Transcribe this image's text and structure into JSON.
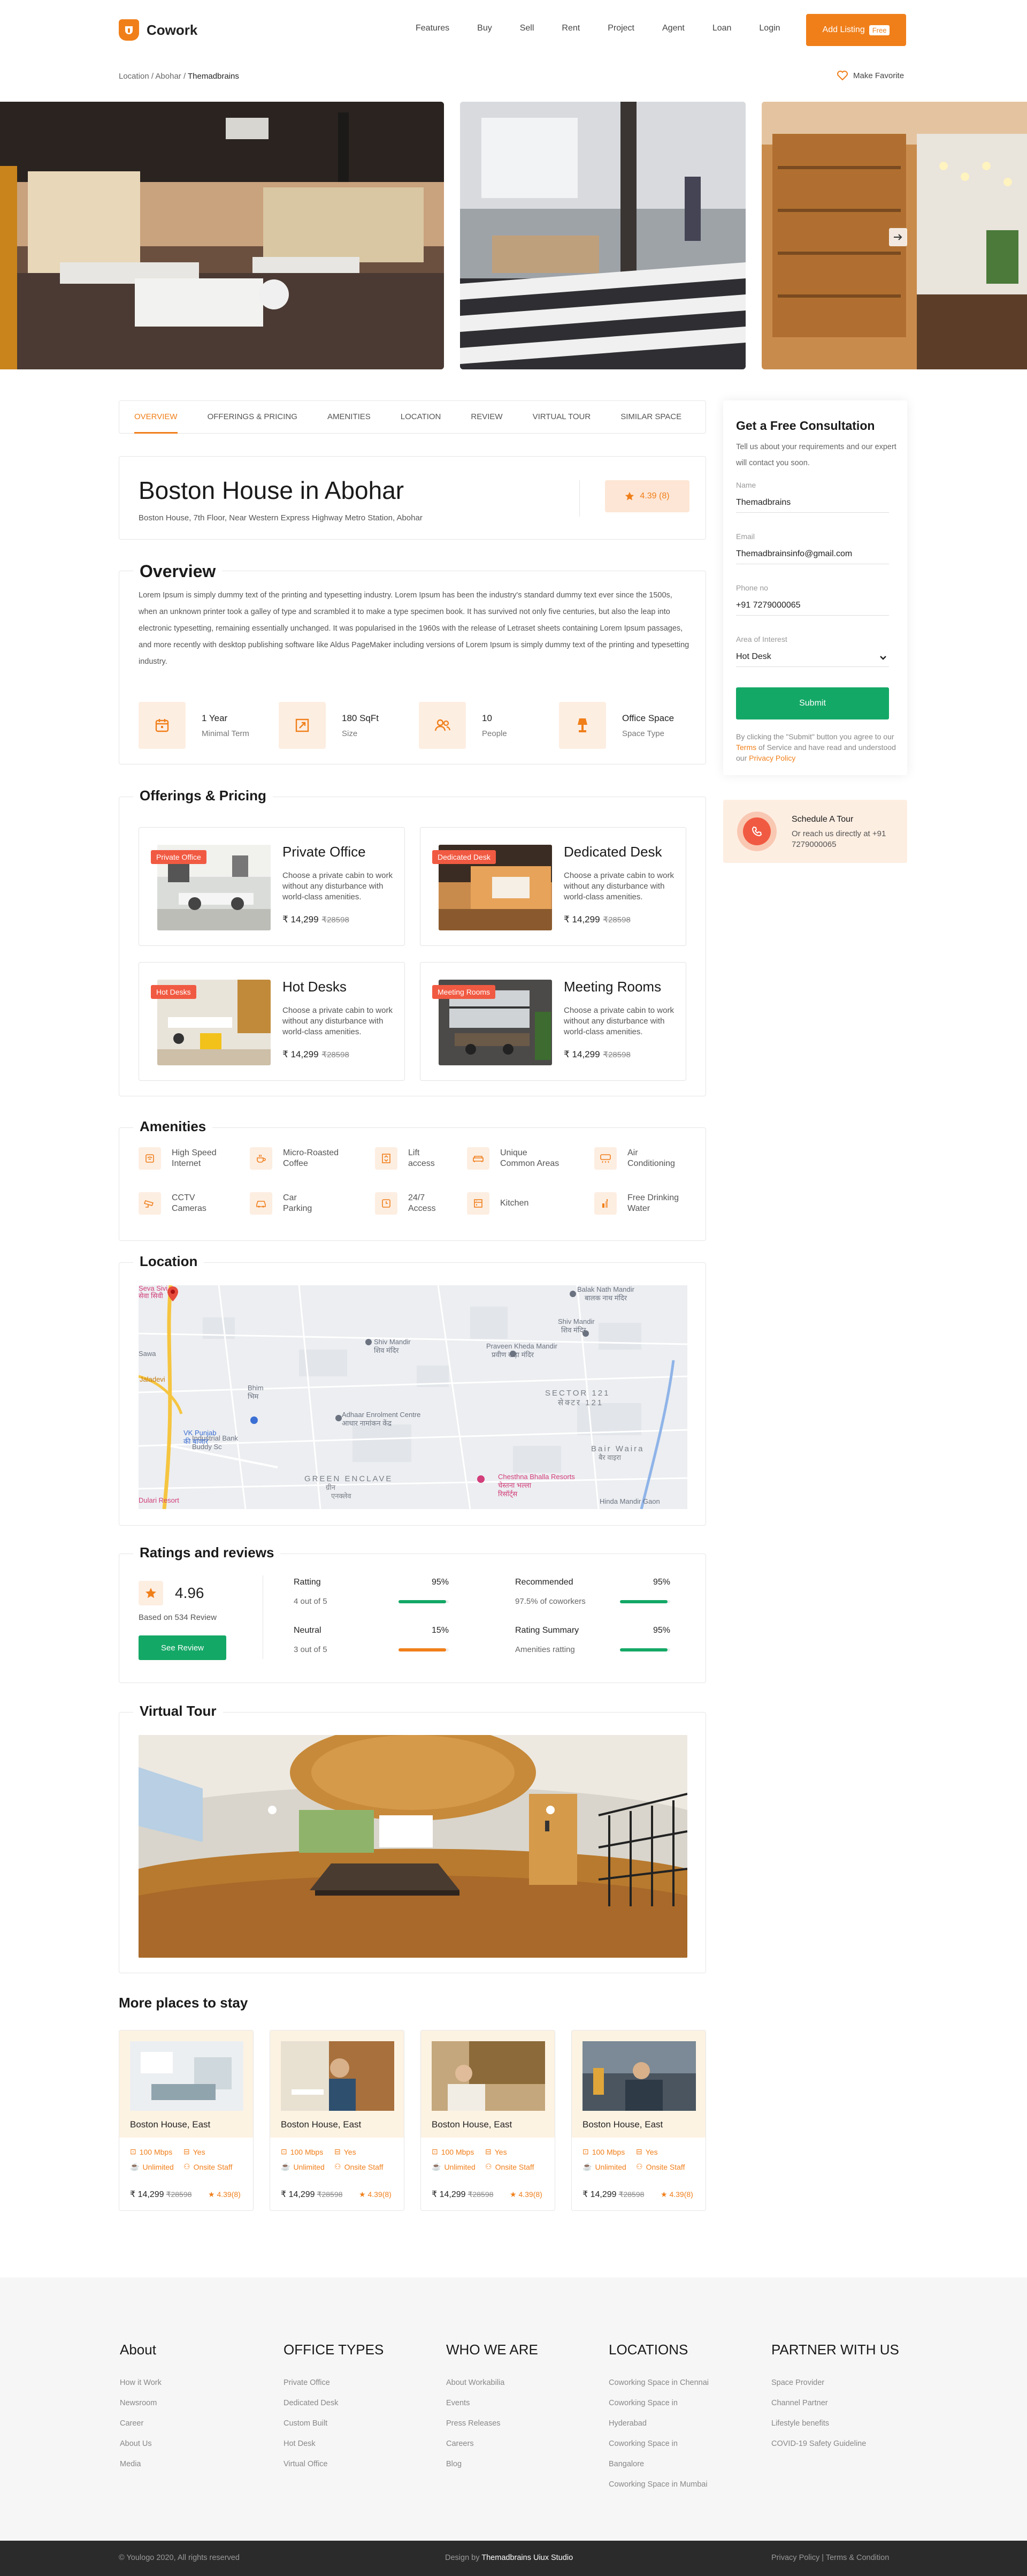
{
  "header": {
    "brand": "Cowork",
    "nav": [
      "Features",
      "Buy",
      "Sell",
      "Rent",
      "Project",
      "Agent",
      "Loan",
      "Login"
    ],
    "add_listing": "Add Listing",
    "free_badge": "Free"
  },
  "breadcrumb": {
    "parts": [
      "Location",
      "Abohar"
    ],
    "current": "Themadbrains"
  },
  "favorite_label": "Make Favorite",
  "tabs": [
    "OVERVIEW",
    "OFFERINGS & PRICING",
    "AMENITIES",
    "LOCATION",
    "REVIEW",
    "VIRTUAL TOUR",
    "SIMILAR SPACE"
  ],
  "property": {
    "title": "Boston House in Abohar",
    "address": "Boston House, 7th Floor, Near Western Express Highway Metro Station, Abohar",
    "rating": "4.39 (8)"
  },
  "overview": {
    "heading": "Overview",
    "text": "Lorem Ipsum is simply dummy text of the printing and typesetting industry. Lorem Ipsum has been the industry's standard dummy text ever since the 1500s, when an unknown printer took a galley of type and scrambled it to make a type specimen book. It has survived not only five centuries, but also the leap into electronic typesetting, remaining essentially unchanged. It was popularised in the 1960s with the release of Letraset sheets containing Lorem Ipsum passages, and more recently with desktop publishing software like Aldus PageMaker including versions of Lorem Ipsum is simply dummy text of the printing and typesetting industry.",
    "facts": [
      {
        "value": "1 Year",
        "label": "Minimal Term",
        "icon": "calendar-icon"
      },
      {
        "value": "180 SqFt",
        "label": "Size",
        "icon": "expand-icon"
      },
      {
        "value": "10",
        "label": "People",
        "icon": "people-icon"
      },
      {
        "value": "Office Space",
        "label": "Space Type",
        "icon": "lamp-icon"
      }
    ]
  },
  "offerings": {
    "heading": "Offerings & Pricing",
    "items": [
      {
        "badge": "Private Office",
        "name": "Private Office",
        "desc": "Choose a private cabin to work without any disturbance with world-class amenities.",
        "price": "₹ 14,299",
        "old": "₹28598"
      },
      {
        "badge": "Dedicated Desk",
        "name": "Dedicated Desk",
        "desc": "Choose a private cabin to work without any disturbance with world-class amenities.",
        "price": "₹ 14,299",
        "old": "₹28598"
      },
      {
        "badge": "Hot Desks",
        "name": "Hot Desks",
        "desc": "Choose a private cabin to work without any disturbance with world-class amenities.",
        "price": "₹ 14,299",
        "old": "₹28598"
      },
      {
        "badge": "Meeting Rooms",
        "name": "Meeting Rooms",
        "desc": "Choose a private cabin to work without any disturbance with world-class amenities.",
        "price": "₹ 14,299",
        "old": "₹28598"
      }
    ]
  },
  "amenities": {
    "heading": "Amenities",
    "items": [
      {
        "line1": "High Speed",
        "line2": "Internet"
      },
      {
        "line1": "Micro-Roasted",
        "line2": "Coffee"
      },
      {
        "line1": "Lift",
        "line2": "access"
      },
      {
        "line1": "Unique",
        "line2": "Common Areas"
      },
      {
        "line1": "Air",
        "line2": "Conditioning"
      },
      {
        "line1": "CCTV",
        "line2": "Cameras"
      },
      {
        "line1": "Car",
        "line2": "Parking"
      },
      {
        "line1": "24/7",
        "line2": "Access"
      },
      {
        "line1": "Kitchen",
        "line2": ""
      },
      {
        "line1": "Free Drinking",
        "line2": "Water"
      }
    ]
  },
  "location": {
    "heading": "Location",
    "map_labels": {
      "balak": "Balak Nath Mandir",
      "balak_hi": "बालक नाथ मंदिर",
      "shiv1": "Shiv Mandir",
      "shiv1_hi": "शिव मंदिर",
      "shiv2": "Shiv Mandir",
      "shiv2_hi": "शिव मंदिर",
      "praveen": "Praveen Kheda Mandir",
      "praveen_hi": "प्रवीण खेड़ा मंदिर",
      "sector": "SECTOR 121",
      "sector_hi": "सेक्टर 121",
      "adhaar": "Adhaar Enrolment Centre",
      "adhaar_hi": "आधार नामांकन केंद्र",
      "industrial": "Industrial Bank",
      "industrial2": "Buddy Sc",
      "vk": "VK Punjab",
      "vk2": "की बाजार",
      "green": "GREEN ENCLAVE",
      "green_hi1": "ग्रीन",
      "green_hi2": "एनक्लेव",
      "chesthna": "Chesthna Bhalla Resorts",
      "chesthna_hi1": "चेस्तना भल्ला",
      "chesthna_hi2": "रिसॉर्ट्स",
      "bair": "Bair Waira",
      "bair_hi": "बैर वाइरा",
      "sawa": "Sawa",
      "bhim": "Bhim",
      "bhim_hi": "भिम",
      "dulari": "Dulari Resort",
      "jaladevi": "Jaladevi",
      "hinda": "Hinda Mandir Gaon",
      "seva": "Seva Sivi",
      "seva_hi": "सेवा सिवी"
    }
  },
  "ratings": {
    "heading": "Ratings and reviews",
    "score": "4.96",
    "based": "Based on 534 Review",
    "see_review": "See Review",
    "rows": [
      {
        "label": "Ratting",
        "sub": "4 out of 5",
        "pct": "95%",
        "fill": 0.95,
        "color": "#14a866"
      },
      {
        "label": "Recommended",
        "sub": "97.5% of coworkers",
        "pct": "95%",
        "fill": 0.95,
        "color": "#14a866"
      },
      {
        "label": "Neutral",
        "sub": "3 out of 5",
        "pct": "15%",
        "fill": 0.95,
        "color": "#f07f1a"
      },
      {
        "label": "Rating Summary",
        "sub": "Amenities ratting",
        "pct": "95%",
        "fill": 0.95,
        "color": "#14a866"
      }
    ]
  },
  "virtual_tour": {
    "heading": "Virtual Tour"
  },
  "more_places": {
    "heading": "More places to stay",
    "items": [
      {
        "name": "Boston House, East",
        "speed": "100 Mbps",
        "yes": "Yes",
        "unlimited": "Unlimited",
        "staff": "Onsite Staff",
        "price": "₹ 14,299",
        "old": "₹28598",
        "rating": "4.39(8)"
      },
      {
        "name": "Boston House, East",
        "speed": "100 Mbps",
        "yes": "Yes",
        "unlimited": "Unlimited",
        "staff": "Onsite Staff",
        "price": "₹ 14,299",
        "old": "₹28598",
        "rating": "4.39(8)"
      },
      {
        "name": "Boston House, East",
        "speed": "100 Mbps",
        "yes": "Yes",
        "unlimited": "Unlimited",
        "staff": "Onsite Staff",
        "price": "₹ 14,299",
        "old": "₹28598",
        "rating": "4.39(8)"
      },
      {
        "name": "Boston House, East",
        "speed": "100 Mbps",
        "yes": "Yes",
        "unlimited": "Unlimited",
        "staff": "Onsite Staff",
        "price": "₹ 14,299",
        "old": "₹28598",
        "rating": "4.39(8)"
      }
    ]
  },
  "consultation": {
    "heading": "Get a Free Consultation",
    "sub": "Tell us about your requirements and our expert will contact you soon.",
    "fields": [
      {
        "label": "Name",
        "value": "Themadbrains"
      },
      {
        "label": "Email",
        "value": "Themadbrainsinfo@gmail.com"
      },
      {
        "label": "Phone no",
        "value": "+91 7279000065"
      },
      {
        "label": "Area of Interest",
        "value": "Hot Desk"
      }
    ],
    "submit": "Submit",
    "note_pre": "By clicking the \"Submit\" button you agree to our",
    "terms": "Terms",
    "note_mid": "of Service and have read and understood our",
    "privacy": "Privacy Policy"
  },
  "schedule": {
    "heading": "Schedule A Tour",
    "text": "Or reach us directly at +91 7279000065"
  },
  "footer": {
    "cols": [
      {
        "title": "About",
        "links": [
          "How it Work",
          "Newsroom",
          "Career",
          "About Us",
          "Media"
        ]
      },
      {
        "title": "OFFICE TYPES",
        "links": [
          "Private Office",
          "Dedicated Desk",
          "Custom Built",
          "Hot Desk",
          "Virtual Office"
        ]
      },
      {
        "title": "WHO WE ARE",
        "links": [
          "About Workabilia",
          "Events",
          "Press Releases",
          "Careers",
          "Blog"
        ]
      },
      {
        "title": "LOCATIONS",
        "links": [
          "Coworking Space in Chennai",
          "Coworking Space in",
          "Hyderabad",
          "Coworking Space in",
          "Bangalore",
          "Coworking Space in Mumbai"
        ]
      },
      {
        "title": "PARTNER WITH US",
        "links": [
          "Space Provider",
          "Channel Partner",
          "Lifestyle benefits",
          "COVID-19 Safety Guideline"
        ]
      }
    ],
    "copyright": "© Youlogo 2020, All rights reserved",
    "design_pre": "Design by",
    "design_by": "Themadbrains Uiux Studio",
    "privacy": "Privacy Policy",
    "terms": "Terms & Condition"
  },
  "colors": {
    "accent": "#f07f1a",
    "green": "#14a866",
    "badge": "#f15a42"
  }
}
